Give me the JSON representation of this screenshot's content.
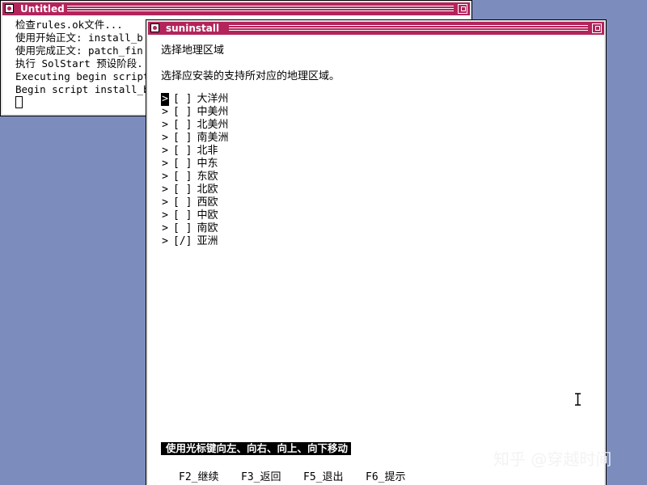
{
  "terminal": {
    "title": "Untitled",
    "lines": [
      "检查rules.ok文件...",
      "使用开始正文: install_b",
      "使用完成正文: patch_fin",
      "执行 SolStart 预设阶段.",
      "Executing begin script",
      "Begin script install_be"
    ]
  },
  "installer": {
    "title": "suninstall",
    "heading": "选择地理区域",
    "instruction": "选择应安装的支持所对应的地理区域。",
    "regions": [
      {
        "label": "大洋州",
        "checkbox": "[ ]",
        "arrow": ">"
      },
      {
        "label": "中美州",
        "checkbox": "[ ]",
        "arrow": ">"
      },
      {
        "label": "北美州",
        "checkbox": "[ ]",
        "arrow": ">"
      },
      {
        "label": "南美洲",
        "checkbox": "[ ]",
        "arrow": ">"
      },
      {
        "label": "北非",
        "checkbox": "[ ]",
        "arrow": ">"
      },
      {
        "label": "中东",
        "checkbox": "[ ]",
        "arrow": ">"
      },
      {
        "label": "东欧",
        "checkbox": "[ ]",
        "arrow": ">"
      },
      {
        "label": "北欧",
        "checkbox": "[ ]",
        "arrow": ">"
      },
      {
        "label": "西欧",
        "checkbox": "[ ]",
        "arrow": ">"
      },
      {
        "label": "中欧",
        "checkbox": "[ ]",
        "arrow": ">"
      },
      {
        "label": "南欧",
        "checkbox": "[ ]",
        "arrow": ">"
      },
      {
        "label": "亚洲",
        "checkbox": "[/]",
        "arrow": ">"
      }
    ],
    "hint": "使用光标键向左、向右、向上、向下移动",
    "function_keys": {
      "f2": "F2_继续",
      "f3": "F3_返回",
      "f5": "F5_退出",
      "f6": "F6_提示"
    }
  },
  "watermark": "知乎 @穿越时间",
  "colors": {
    "desktop": "#7b8cbd",
    "titlebar": "#b3245b",
    "window_bg": "#ffffff"
  }
}
